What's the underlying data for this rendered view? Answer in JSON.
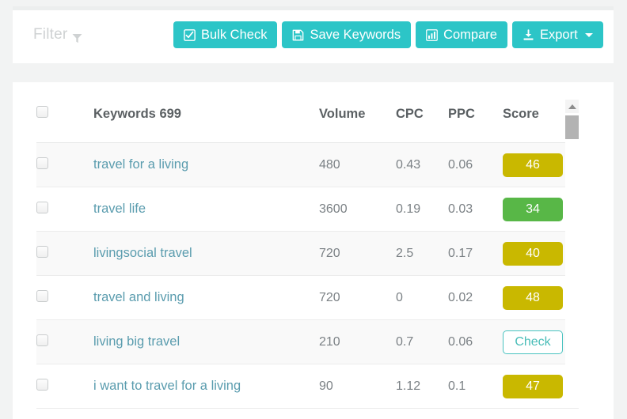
{
  "toolbar": {
    "filter_label": "Filter",
    "filter_icon": "funnel-icon",
    "buttons": [
      {
        "label": "Bulk Check",
        "icon": "checkbox-checked-icon",
        "caret": false
      },
      {
        "label": "Save Keywords",
        "icon": "floppy-disk-icon",
        "caret": false
      },
      {
        "label": "Compare",
        "icon": "bar-chart-icon",
        "caret": false
      },
      {
        "label": "Export",
        "icon": "download-icon",
        "caret": true
      }
    ]
  },
  "table": {
    "headers": {
      "select_all": "",
      "keywords": "Keywords 699",
      "volume": "Volume",
      "cpc": "CPC",
      "ppc": "PPC",
      "score": "Score"
    },
    "rows": [
      {
        "keyword": "travel for a living",
        "volume": "480",
        "cpc": "0.43",
        "ppc": "0.06",
        "score": "46",
        "score_type": "olive",
        "checked": false
      },
      {
        "keyword": "travel life",
        "volume": "3600",
        "cpc": "0.19",
        "ppc": "0.03",
        "score": "34",
        "score_type": "green",
        "checked": false
      },
      {
        "keyword": "livingsocial travel",
        "volume": "720",
        "cpc": "2.5",
        "ppc": "0.17",
        "score": "40",
        "score_type": "olive",
        "checked": false
      },
      {
        "keyword": "travel and living",
        "volume": "720",
        "cpc": "0",
        "ppc": "0.02",
        "score": "48",
        "score_type": "olive",
        "checked": false
      },
      {
        "keyword": "living big travel",
        "volume": "210",
        "cpc": "0.7",
        "ppc": "0.06",
        "score": "Check",
        "score_type": "button",
        "checked": false
      },
      {
        "keyword": "i want to travel for a living",
        "volume": "90",
        "cpc": "1.12",
        "ppc": "0.1",
        "score": "47",
        "score_type": "olive",
        "checked": false
      }
    ]
  },
  "scrollbar": {
    "up_arrow": "scroll-up-arrow-icon"
  },
  "colors": {
    "accent_teal": "#2cc5c7",
    "score_olive": "#c9b800",
    "score_green": "#58b747",
    "link_blue": "#5a9cae",
    "page_bg": "#f2f3f3"
  }
}
